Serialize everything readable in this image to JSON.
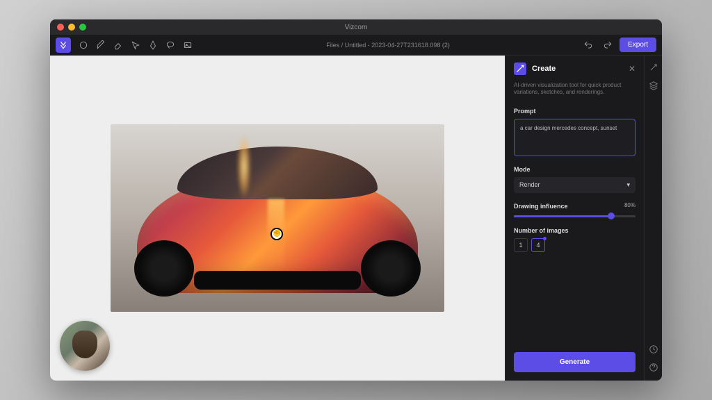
{
  "app": {
    "title": "Vizcom"
  },
  "breadcrumbs": "Files / Untitled - 2023-04-27T231618.098 (2)",
  "toolbar": {
    "export": "Export"
  },
  "panel": {
    "title": "Create",
    "description": "AI-driven visualization tool for quick product variations, sketches, and renderings.",
    "prompt_label": "Prompt",
    "prompt_value": "a car design mercedes concept, sunset",
    "mode_label": "Mode",
    "mode_value": "Render",
    "influence_label": "Drawing influence",
    "influence_value": "80%",
    "influence_pct": 80,
    "num_images_label": "Number of images",
    "num_options": [
      "1",
      "4"
    ],
    "num_selected": "4",
    "generate": "Generate"
  }
}
